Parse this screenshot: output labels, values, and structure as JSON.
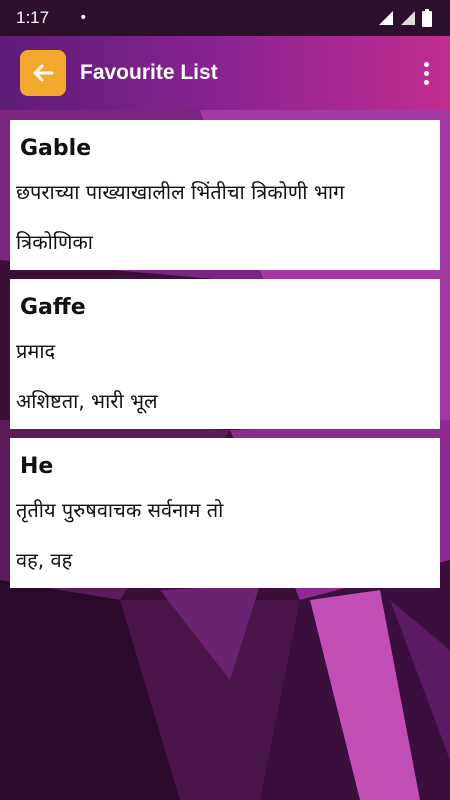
{
  "status_bar": {
    "time": "1:17",
    "dot": "•"
  },
  "app_bar": {
    "title": "Favourite List"
  },
  "favourites": [
    {
      "word": "Gable",
      "meaning_1": "छपराच्या पाख्याखालील भिंतीचा त्रिकोणी भाग",
      "meaning_2": "त्रिकोणिका"
    },
    {
      "word": "Gaffe",
      "meaning_1": "प्रमाद",
      "meaning_2": "अशिष्टता, भारी भूल"
    },
    {
      "word": "He",
      "meaning_1": "तृतीय पुरुषवाचक सर्वनाम तो",
      "meaning_2": "वह, वह"
    }
  ],
  "colors": {
    "accent": "#f2a92c",
    "appbar_start": "#5c1c78",
    "appbar_end": "#c02d8f",
    "card": "#ffffff"
  }
}
